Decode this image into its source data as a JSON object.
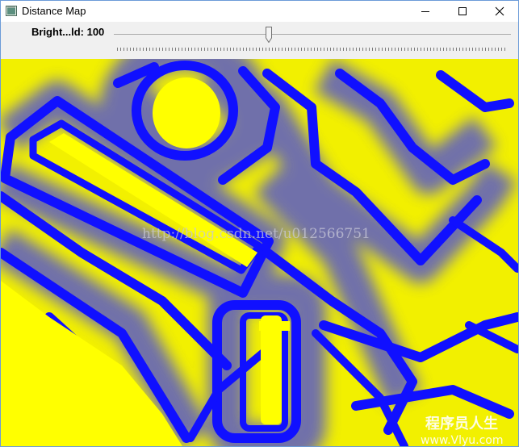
{
  "window": {
    "title": "Distance Map",
    "buttons": {
      "minimize": "minimize-icon",
      "maximize": "maximize-icon",
      "close": "close-icon"
    }
  },
  "trackbar": {
    "label": "Bright...ld: 100",
    "value": 100,
    "level_fraction": 0.39
  },
  "image": {
    "colors": {
      "yellow": "#ffff00",
      "blue": "#0f0fff"
    },
    "watermark_url": "http://blog.csdn.net/u012566751",
    "watermark_site_title": "程序员人生",
    "watermark_site_url": "www.Vlyu.com"
  }
}
